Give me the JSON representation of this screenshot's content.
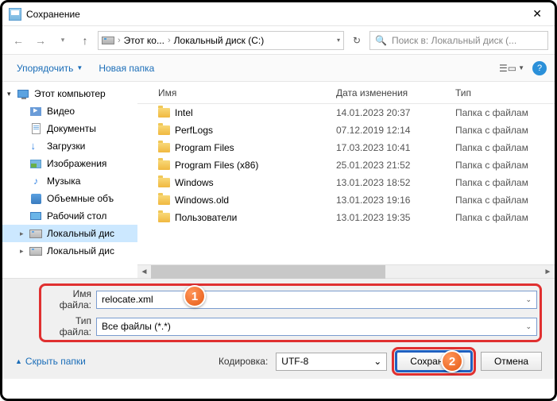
{
  "window": {
    "title": "Сохранение"
  },
  "nav": {
    "breadcrumb": {
      "pc": "Этот ко...",
      "drive": "Локальный диск (C:)"
    },
    "search_placeholder": "Поиск в: Локальный диск (..."
  },
  "toolbar": {
    "organize": "Упорядочить",
    "newfolder": "Новая папка"
  },
  "tree": {
    "pc": "Этот компьютер",
    "items": [
      {
        "label": "Видео",
        "icon": "video"
      },
      {
        "label": "Документы",
        "icon": "doc"
      },
      {
        "label": "Загрузки",
        "icon": "down"
      },
      {
        "label": "Изображения",
        "icon": "img"
      },
      {
        "label": "Музыка",
        "icon": "music"
      },
      {
        "label": "Объемные объ",
        "icon": "3d"
      },
      {
        "label": "Рабочий стол",
        "icon": "desk"
      },
      {
        "label": "Локальный дис",
        "icon": "drv",
        "selected": true
      },
      {
        "label": "Локальный дис",
        "icon": "drv"
      }
    ]
  },
  "columns": {
    "name": "Имя",
    "date": "Дата изменения",
    "type": "Тип"
  },
  "files": [
    {
      "name": "Intel",
      "date": "14.01.2023 20:37",
      "type": "Папка с файлам"
    },
    {
      "name": "PerfLogs",
      "date": "07.12.2019 12:14",
      "type": "Папка с файлам"
    },
    {
      "name": "Program Files",
      "date": "17.03.2023 10:41",
      "type": "Папка с файлам"
    },
    {
      "name": "Program Files (x86)",
      "date": "25.01.2023 21:52",
      "type": "Папка с файлам"
    },
    {
      "name": "Windows",
      "date": "13.01.2023 18:52",
      "type": "Папка с файлам"
    },
    {
      "name": "Windows.old",
      "date": "13.01.2023 19:16",
      "type": "Папка с файлам"
    },
    {
      "name": "Пользователи",
      "date": "13.01.2023 19:35",
      "type": "Папка с файлам"
    }
  ],
  "form": {
    "filename_label": "Имя файла:",
    "filename_value": "relocate.xml",
    "filetype_label": "Тип файла:",
    "filetype_value": "Все файлы  (*.*)",
    "encoding_label": "Кодировка:",
    "encoding_value": "UTF-8",
    "hide": "Скрыть папки",
    "save": "Сохранить",
    "cancel": "Отмена"
  },
  "badges": {
    "b1": "1",
    "b2": "2"
  }
}
